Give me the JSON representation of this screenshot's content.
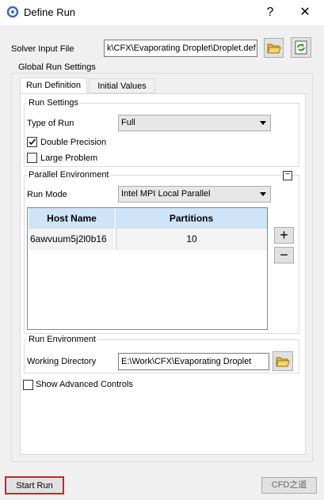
{
  "window": {
    "title": "Define Run",
    "help_label": "?",
    "close_label": "✕"
  },
  "solver_input": {
    "label": "Solver Input File",
    "value": "k\\CFX\\Evaporating Droplet\\Droplet.def"
  },
  "global_settings": {
    "title": "Global Run Settings",
    "tabs": [
      {
        "label": "Run Definition"
      },
      {
        "label": "Initial Values"
      }
    ]
  },
  "run_settings": {
    "title": "Run Settings",
    "type_label": "Type of Run",
    "type_value": "Full",
    "double_precision_label": "Double Precision",
    "large_problem_label": "Large Problem"
  },
  "parallel": {
    "title": "Parallel Environment",
    "run_mode_label": "Run Mode",
    "run_mode_value": "Intel MPI Local Parallel",
    "columns": [
      "Host Name",
      "Partitions"
    ],
    "rows": [
      {
        "host": "6awvuum5j2l0b16",
        "partitions": "10"
      }
    ],
    "add_label": "+",
    "remove_label": "−",
    "collapse_label": "−"
  },
  "run_env": {
    "title": "Run Environment",
    "wd_label": "Working Directory",
    "wd_value": "E:\\Work\\CFX\\Evaporating Droplet"
  },
  "advanced": {
    "label": "Show Advanced Controls"
  },
  "footer": {
    "start_label": "Start Run",
    "watermark": "CFD之道"
  }
}
